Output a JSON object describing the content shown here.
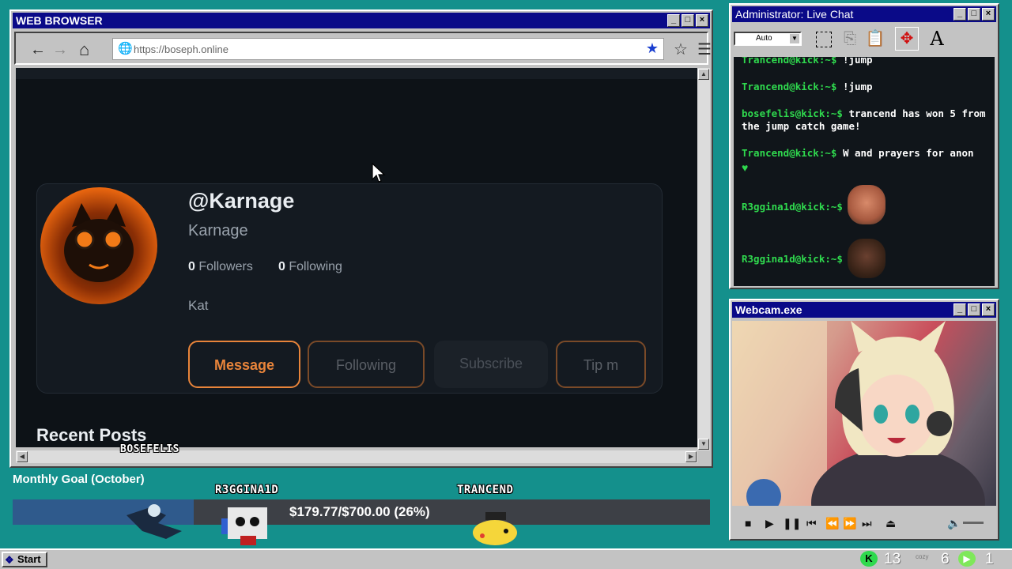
{
  "browser": {
    "title": "WEB BROWSER",
    "url": "https://boseph.online",
    "profile": {
      "handle": "@Karnage",
      "display_name": "Karnage",
      "followers_count": "0",
      "followers_label": "Followers",
      "following_count": "0",
      "following_label": "Following",
      "bio": "Kat",
      "buttons": {
        "message": "Message",
        "following": "Following",
        "subscribe": "Subscribe",
        "tip": "Tip m"
      }
    },
    "recent_posts_label": "Recent Posts"
  },
  "chat": {
    "title": "Administrator: Live Chat",
    "font_size_select": "Auto",
    "messages": [
      {
        "user": "Trancend@kick:~$",
        "text": "!jump"
      },
      {
        "user": "Trancend@kick:~$",
        "text": "!jump"
      },
      {
        "user": "bosefelis@kick:~$",
        "text": "trancend has won 5 from"
      },
      {
        "user": "",
        "text": "the jump catch game!"
      },
      {
        "user": "Trancend@kick:~$",
        "text": "W and prayers for anon"
      },
      {
        "user": "R3ggina1d@kick:~$",
        "text": ""
      },
      {
        "user": "R3ggina1d@kick:~$",
        "text": ""
      }
    ]
  },
  "webcam": {
    "title": "Webcam.exe"
  },
  "overlay": {
    "goal_title": "Monthly Goal (October)",
    "goal_amount": "$179.77/$700.00 (26%)",
    "goal_progress": 0.26,
    "names": [
      "BOSEFELIS",
      "R3GGINA1D",
      "TRANCEND"
    ]
  },
  "taskbar": {
    "start_label": "Start",
    "stat1": "13",
    "stat2": "6",
    "stat3": "1",
    "cozy_label": "cozy"
  },
  "colors": {
    "accent_orange": "#e8843a",
    "chat_user_green": "#2fd94e",
    "titlebar": "#0a0a88"
  }
}
